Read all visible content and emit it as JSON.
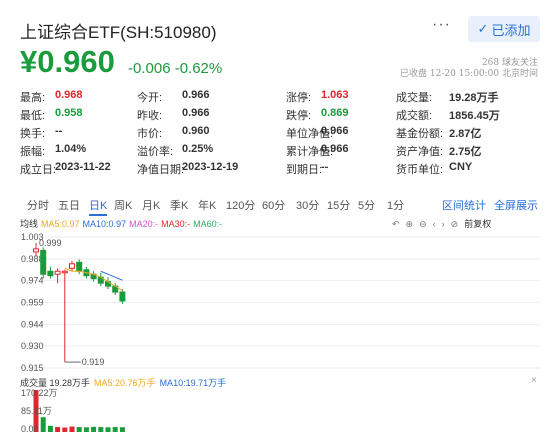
{
  "header": {
    "title": "上证综合ETF(SH:510980)",
    "more_label": "···",
    "added_label": "已添加",
    "price": "¥0.960",
    "change": "-0.006  -0.62%",
    "followers": "268 球友关注",
    "close_time": "已收盘 12-20 15:00:00 北京时间"
  },
  "stats": [
    {
      "label": "最高:",
      "value": "0.968",
      "color": "red"
    },
    {
      "label": "今开:",
      "value": "0.966",
      "color": ""
    },
    {
      "label": "涨停:",
      "value": "1.063",
      "color": "red"
    },
    {
      "label": "成交量:",
      "value": "19.28万手",
      "color": ""
    },
    {
      "label": "最低:",
      "value": "0.958",
      "color": "green"
    },
    {
      "label": "昨收:",
      "value": "0.966",
      "color": ""
    },
    {
      "label": "跌停:",
      "value": "0.869",
      "color": "green"
    },
    {
      "label": "成交额:",
      "value": "1856.45万",
      "color": ""
    },
    {
      "label": "换手:",
      "value": "--",
      "color": ""
    },
    {
      "label": "市价:",
      "value": "0.960",
      "color": ""
    },
    {
      "label": "单位净值:",
      "value": "0.966",
      "color": ""
    },
    {
      "label": "基金份额:",
      "value": "2.87亿",
      "color": ""
    },
    {
      "label": "振幅:",
      "value": "1.04%",
      "color": ""
    },
    {
      "label": "溢价率:",
      "value": "0.25%",
      "color": ""
    },
    {
      "label": "累计净值:",
      "value": "0.966",
      "color": ""
    },
    {
      "label": "资产净值:",
      "value": "2.75亿",
      "color": ""
    },
    {
      "label": "成立日:",
      "value": "2023-11-22",
      "color": ""
    },
    {
      "label": "净值日期:",
      "value": "2023-12-19",
      "color": ""
    },
    {
      "label": "到期日:",
      "value": "--",
      "color": ""
    },
    {
      "label": "货币单位:",
      "value": "CNY",
      "color": ""
    }
  ],
  "tabs": [
    "分时",
    "五日",
    "日K",
    "周K",
    "月K",
    "季K",
    "年K",
    "120分",
    "60分",
    "30分",
    "15分",
    "5分",
    "1分"
  ],
  "active_tab": "日K",
  "tab_right": [
    "区间统计",
    "全屏展示"
  ],
  "ma_legend": [
    {
      "label": "均线",
      "color": "#333333"
    },
    {
      "label": "MA5:0.97",
      "color": "#f5a623"
    },
    {
      "label": "MA10:0.97",
      "color": "#2a6fd8"
    },
    {
      "label": "MA20:-",
      "color": "#d94fd8"
    },
    {
      "label": "MA30:-",
      "color": "#e0262d"
    },
    {
      "label": "MA60:-",
      "color": "#27b36a"
    }
  ],
  "tools": {
    "icons": [
      "↶",
      "⊕",
      "⊖",
      "‹",
      "›",
      "⊘"
    ],
    "adjust_label": "前复权"
  },
  "chart_data": {
    "type": "candlestick",
    "y_ticks": [
      "1.003",
      "0.988",
      "0.974",
      "0.959",
      "0.944",
      "0.930",
      "0.915"
    ],
    "high_label": "0.999",
    "low_label": "0.919",
    "candles": [
      {
        "o": 0.993,
        "h": 0.999,
        "l": 0.99,
        "c": 0.995
      },
      {
        "o": 0.994,
        "h": 0.996,
        "l": 0.975,
        "c": 0.978
      },
      {
        "o": 0.98,
        "h": 0.983,
        "l": 0.975,
        "c": 0.977
      },
      {
        "o": 0.978,
        "h": 0.982,
        "l": 0.972,
        "c": 0.98
      },
      {
        "o": 0.979,
        "h": 0.981,
        "l": 0.919,
        "c": 0.98
      },
      {
        "o": 0.982,
        "h": 0.987,
        "l": 0.98,
        "c": 0.985
      },
      {
        "o": 0.986,
        "h": 0.988,
        "l": 0.978,
        "c": 0.98
      },
      {
        "o": 0.981,
        "h": 0.983,
        "l": 0.975,
        "c": 0.977
      },
      {
        "o": 0.978,
        "h": 0.98,
        "l": 0.973,
        "c": 0.975
      },
      {
        "o": 0.976,
        "h": 0.979,
        "l": 0.97,
        "c": 0.972
      },
      {
        "o": 0.973,
        "h": 0.976,
        "l": 0.968,
        "c": 0.97
      },
      {
        "o": 0.97,
        "h": 0.972,
        "l": 0.964,
        "c": 0.966
      },
      {
        "o": 0.966,
        "h": 0.968,
        "l": 0.958,
        "c": 0.96
      }
    ],
    "ma5": [
      null,
      null,
      null,
      null,
      0.982,
      0.98,
      0.98,
      0.979,
      0.978,
      0.976,
      0.973,
      0.97,
      0.967
    ],
    "ma10": [
      null,
      null,
      null,
      null,
      null,
      null,
      null,
      null,
      null,
      0.98,
      0.978,
      0.976,
      0.974
    ]
  },
  "volume": {
    "legend": [
      {
        "label": "成交量 19.28万手",
        "color": "#333333"
      },
      {
        "label": "MA5:20.76万手",
        "color": "#f5a623"
      },
      {
        "label": "MA10:19.71万手",
        "color": "#2a6fd8"
      }
    ],
    "close_icon": "×",
    "y_ticks": [
      "170.22万",
      "85.11万",
      "0.00"
    ],
    "bars": [
      170.22,
      60,
      25,
      20,
      18,
      22,
      20,
      19,
      21,
      20,
      19,
      20,
      19.28
    ],
    "bar_colors": [
      "red",
      "green",
      "green",
      "red",
      "red",
      "red",
      "green",
      "green",
      "green",
      "green",
      "green",
      "green",
      "green"
    ]
  }
}
